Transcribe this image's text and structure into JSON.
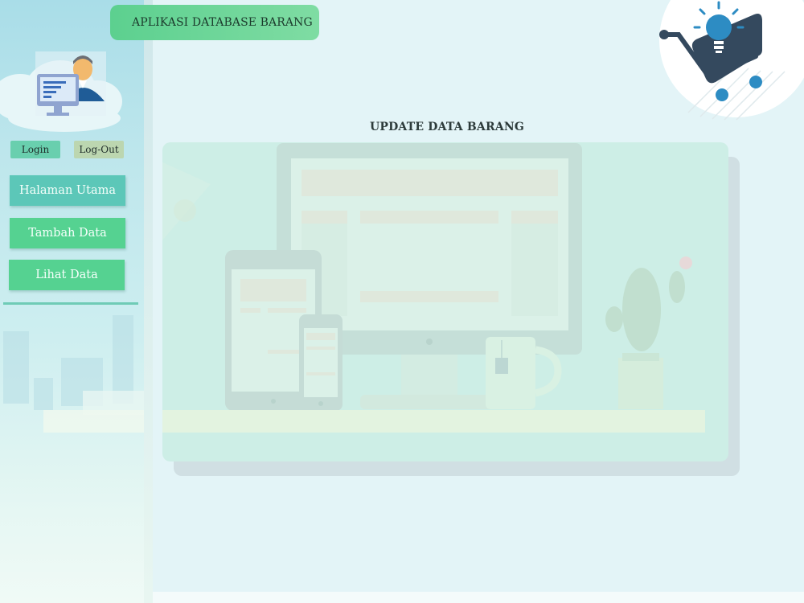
{
  "app": {
    "title": "APLIKASI DATABASE BARANG"
  },
  "auth": {
    "login_label": "Login",
    "logout_label": "Log-Out"
  },
  "nav": {
    "home_label": "Halaman Utama",
    "add_label": "Tambah Data",
    "view_label": "Lihat Data"
  },
  "page": {
    "title": "UPDATE DATA BARANG"
  },
  "icons": {
    "user": "user-computer-icon",
    "logo": "shopping-cart-bulb-icon",
    "illustration": "devices-desk-illustration"
  },
  "colors": {
    "banner": "#5cd08f",
    "nav_home": "#5cc7b8",
    "nav_green": "#55d291",
    "login": "#69cfae",
    "logout": "#bcd6b0",
    "background": "#e3f4f7"
  }
}
